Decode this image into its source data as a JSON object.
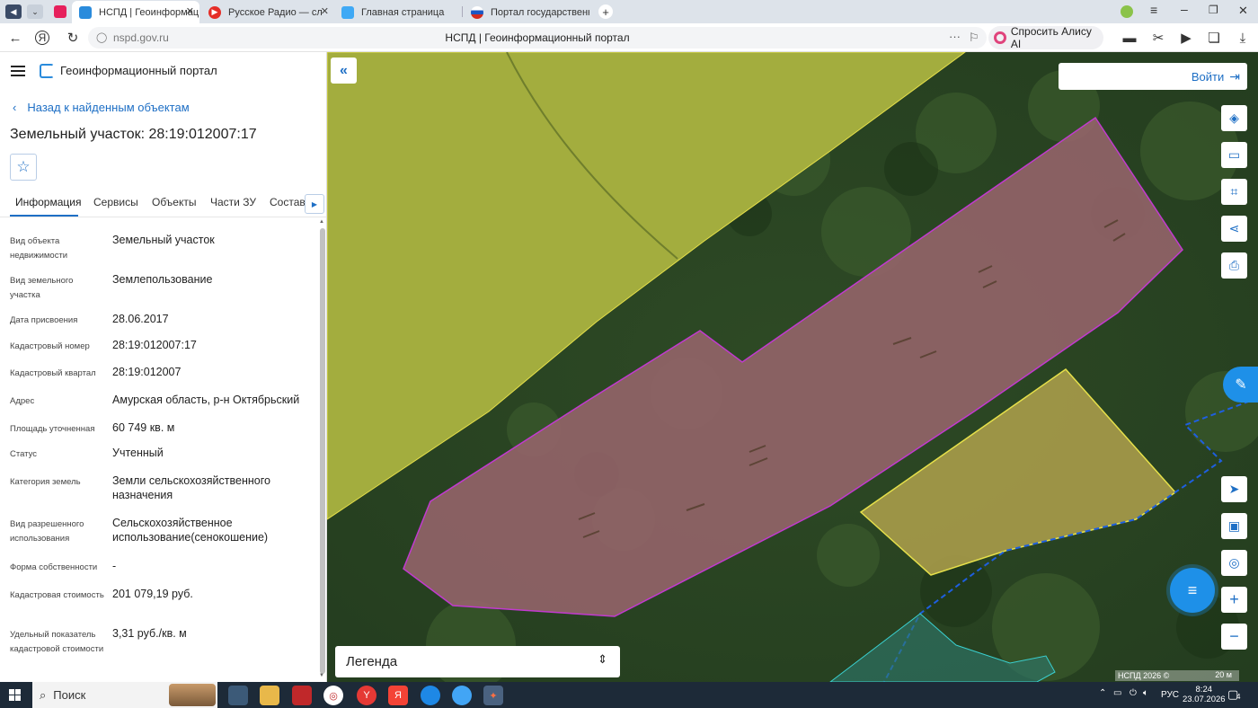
{
  "browser": {
    "tabs": [
      {
        "label": "НСПД | Геоинформац",
        "active": true
      },
      {
        "label": "Русское Радио — сл",
        "active": false
      },
      {
        "label": "Главная страница",
        "active": false
      },
      {
        "label": "Портал государственны",
        "active": false
      }
    ],
    "address": "nspd.gov.ru",
    "page_title": "НСПД | Геоинформационный портал",
    "alisa_label": "Спросить Алису AI"
  },
  "panel": {
    "portal_title": "Геоинформационный портал",
    "back_label": "Назад к найденным объектам",
    "parcel_title": "Земельный участок: 28:19:012007:17",
    "tabs": [
      "Информация",
      "Сервисы",
      "Объекты",
      "Части ЗУ",
      "Состав"
    ],
    "rows": [
      {
        "label": "Вид объекта недвижимости",
        "value": "Земельный участок"
      },
      {
        "label": "Вид земельного участка",
        "value": "Землепользование"
      },
      {
        "label": "Дата присвоения",
        "value": "28.06.2017"
      },
      {
        "label": "Кадастровый номер",
        "value": "28:19:012007:17"
      },
      {
        "label": "Кадастровый квартал",
        "value": "28:19:012007"
      },
      {
        "label": "Адрес",
        "value": "Амурская область, р-н Октябрьский"
      },
      {
        "label": "Площадь уточненная",
        "value": "60 749 кв. м"
      },
      {
        "label": "Статус",
        "value": "Учтенный"
      },
      {
        "label": "Категория земель",
        "value": "Земли сельскохозяйственного назначения"
      },
      {
        "label": "Вид разрешенного использования",
        "value": "Сельскохозяйственное использование(сенокошение)"
      },
      {
        "label": "Форма собственности",
        "value": "-"
      },
      {
        "label": "Кадастровая стоимость",
        "value": "201 079,19 руб."
      },
      {
        "label": "Удельный показатель кадастровой стоимости",
        "value": "3,31 руб./кв. м"
      }
    ]
  },
  "map": {
    "login_label": "Войти",
    "legend_label": "Легенда",
    "copyright": "НСПД 2026 ©",
    "scale": "20 м",
    "colors": {
      "selected_parcel": "#c23ad0",
      "other_parcel": "#e6e04a",
      "boundary": "#1e5fe0"
    }
  },
  "taskbar": {
    "search_label": "Поиск",
    "lang": "РУС",
    "time": "8:24",
    "date": "23.07.2026",
    "notifications": "4"
  }
}
